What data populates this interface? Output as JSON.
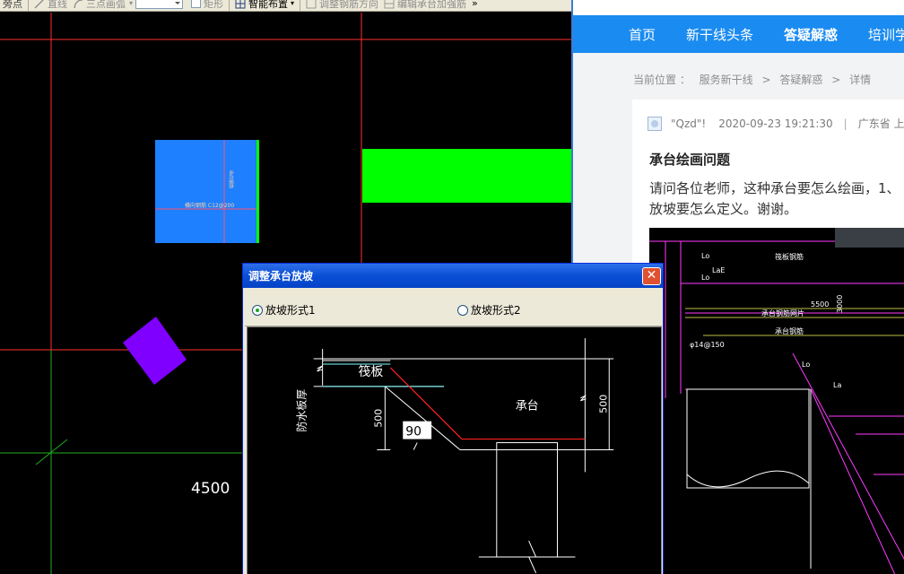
{
  "cad": {
    "toolbar": {
      "point_label": "旁点",
      "line_label": "直线",
      "arc_label": "三点画弧",
      "rect_label": "矩形",
      "smart_layout_label": "智能布置",
      "adjust_rebar_label": "调整钢筋方向",
      "edit_rebar_label": "编辑承台加强筋",
      "more_label": "»"
    },
    "beam_label": "横向钢筋 C12@200",
    "dimension_label": "4500"
  },
  "web": {
    "nav": [
      "首页",
      "新干线头条",
      "答疑解惑",
      "培训学"
    ],
    "nav_active_index": 2,
    "breadcrumb": {
      "prefix": "当前位置 ：",
      "items": [
        "服务新干线",
        ">",
        "答疑解惑",
        ">",
        "详情"
      ]
    },
    "question": {
      "author": "\"Qzd\"!",
      "time": "2020-09-23 19:21:30",
      "separator": "|",
      "location": "广东省 上",
      "title": "承台绘画问题",
      "body_line1": "请问各位老师，这种承台要怎么绘画，1、",
      "body_line2": "放坡要怎么定义。谢谢。"
    },
    "image_labels": {
      "lo1": "Lo",
      "lae": "LaE",
      "lo2": "Lo",
      "slab": "筏板钢筋",
      "dim5500": "5500",
      "dim3000": "3000",
      "top_rebar": "承台钢筋网片",
      "cap_rebar": "承台钢筋",
      "stirrup": "φ14@150",
      "la": "La",
      "la2": "Lo"
    }
  },
  "dialog": {
    "title": "调整承台放坡",
    "close_label": "✕",
    "option1": "放坡形式1",
    "option2": "放坡形式2",
    "selected_option": 1,
    "diagram": {
      "slab_label": "筏板",
      "waterproof_label": "防水板厚",
      "dim_500_left": "500",
      "angle_value": "90",
      "cap_label": "承台",
      "dim_500_right": "500"
    }
  },
  "colors": {
    "cad_background": "#000000",
    "axis_red": "#ff3030",
    "column_blue": "#1e7fff",
    "beam_green": "#00ff00",
    "purple_shape": "#8000ff",
    "nav_blue": "#1a8bf0"
  }
}
